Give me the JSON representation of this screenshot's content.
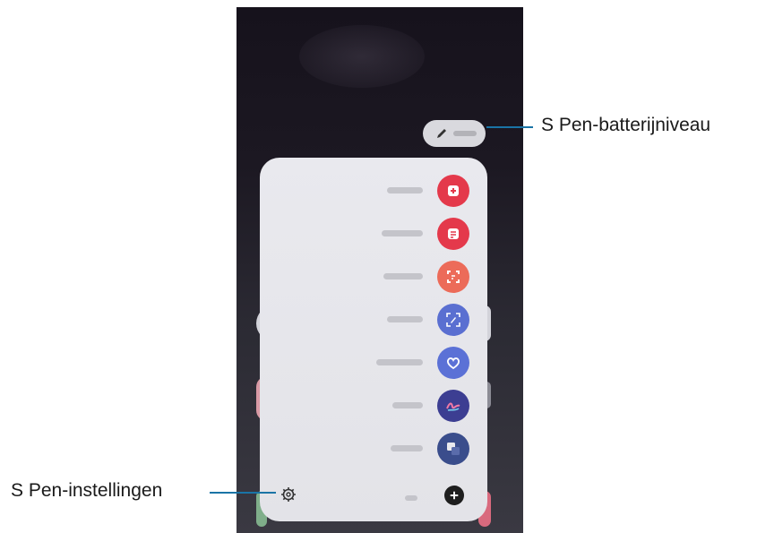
{
  "callouts": {
    "battery": "S Pen-batterijniveau",
    "settings": "S Pen-instellingen"
  },
  "panel_items": [
    {
      "icon": "create-note-icon",
      "color": "#e4394b"
    },
    {
      "icon": "view-all-notes-icon",
      "color": "#e4394b"
    },
    {
      "icon": "smart-select-icon",
      "color": "#ec6b59"
    },
    {
      "icon": "screen-write-icon",
      "color": "#5a6fd1"
    },
    {
      "icon": "live-messages-icon",
      "color": "#5b71d6"
    },
    {
      "icon": "ar-doodle-icon",
      "color": "#3c3e92"
    },
    {
      "icon": "translate-icon",
      "color": "#3a4d8c"
    }
  ],
  "colors": {
    "callout_line": "#1a74a6",
    "panel_bg": "#e6e6eb"
  }
}
